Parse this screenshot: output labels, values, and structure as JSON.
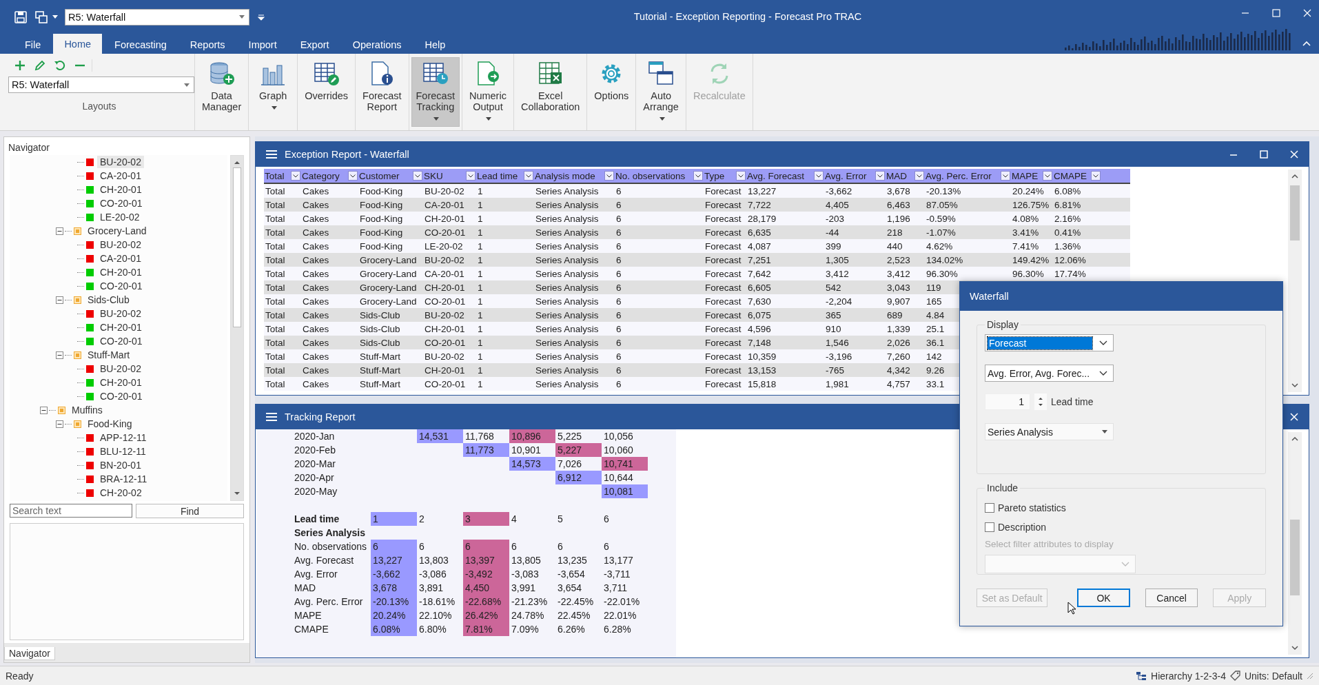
{
  "window": {
    "title": "Tutorial - Exception Reporting - Forecast Pro TRAC",
    "layout_combo": "R5: Waterfall"
  },
  "tabs": [
    {
      "label": "File",
      "selected": false
    },
    {
      "label": "Home",
      "selected": true
    },
    {
      "label": "Forecasting",
      "selected": false
    },
    {
      "label": "Reports",
      "selected": false
    },
    {
      "label": "Import",
      "selected": false
    },
    {
      "label": "Export",
      "selected": false
    },
    {
      "label": "Operations",
      "selected": false
    },
    {
      "label": "Help",
      "selected": false
    }
  ],
  "ribbon": {
    "layouts": {
      "combo": "R5: Waterfall",
      "label": "Layouts"
    },
    "buttons": [
      {
        "label": "Data Manager",
        "dropdown": false,
        "pressed": false,
        "disabled": false
      },
      {
        "label": "Graph",
        "dropdown": true,
        "pressed": false,
        "disabled": false
      },
      {
        "label": "Overrides",
        "dropdown": false,
        "pressed": false,
        "disabled": false
      },
      {
        "label": "Forecast Report",
        "dropdown": false,
        "pressed": false,
        "disabled": false
      },
      {
        "label": "Forecast Tracking",
        "dropdown": true,
        "pressed": true,
        "disabled": false
      },
      {
        "label": "Numeric Output",
        "dropdown": true,
        "pressed": false,
        "disabled": false
      },
      {
        "label": "Excel Collaboration",
        "dropdown": false,
        "pressed": false,
        "disabled": false
      },
      {
        "label": "Options",
        "dropdown": false,
        "pressed": false,
        "disabled": false
      },
      {
        "label": "Auto Arrange",
        "dropdown": true,
        "pressed": false,
        "disabled": false
      },
      {
        "label": "Recalculate",
        "dropdown": false,
        "pressed": false,
        "disabled": true
      }
    ]
  },
  "navigator": {
    "title": "Navigator",
    "tree": [
      {
        "children": [
          {
            "children": [
              {
                "label": "BU-20-02",
                "color": "#ee0000",
                "selected": true
              },
              {
                "label": "CA-20-01",
                "color": "#ee0000",
                "selected": false
              },
              {
                "label": "CH-20-01",
                "color": "#00cc00",
                "selected": false
              },
              {
                "label": "CO-20-01",
                "color": "#00cc00",
                "selected": false
              },
              {
                "label": "LE-20-02",
                "color": "#00cc00",
                "selected": false
              }
            ]
          },
          {
            "label": "Grocery-Land",
            "expanded": true,
            "selected": false,
            "children": [
              {
                "label": "BU-20-02",
                "color": "#ee0000",
                "selected": false
              },
              {
                "label": "CA-20-01",
                "color": "#ee0000",
                "selected": false
              },
              {
                "label": "CH-20-01",
                "color": "#00cc00",
                "selected": false
              },
              {
                "label": "CO-20-01",
                "color": "#00cc00",
                "selected": false
              }
            ]
          },
          {
            "label": "Sids-Club",
            "expanded": true,
            "selected": false,
            "children": [
              {
                "label": "BU-20-02",
                "color": "#ee0000",
                "selected": false
              },
              {
                "label": "CH-20-01",
                "color": "#00cc00",
                "selected": false
              },
              {
                "label": "CO-20-01",
                "color": "#00cc00",
                "selected": false
              }
            ]
          },
          {
            "label": "Stuff-Mart",
            "expanded": true,
            "selected": false,
            "children": [
              {
                "label": "BU-20-02",
                "color": "#ee0000",
                "selected": false
              },
              {
                "label": "CH-20-01",
                "color": "#00cc00",
                "selected": false
              },
              {
                "label": "CO-20-01",
                "color": "#00cc00",
                "selected": false
              }
            ]
          }
        ]
      },
      {
        "label": "Muffins",
        "expanded": true,
        "selected": false,
        "children": [
          {
            "label": "Food-King",
            "expanded": true,
            "selected": false,
            "children": [
              {
                "label": "APP-12-11",
                "color": "#ee0000",
                "selected": false
              },
              {
                "label": "BLU-12-11",
                "color": "#ee0000",
                "selected": false
              },
              {
                "label": "BN-20-01",
                "color": "#ee0000",
                "selected": false
              },
              {
                "label": "BRA-12-11",
                "color": "#ee0000",
                "selected": false
              },
              {
                "label": "CH-20-02",
                "color": "#ee0000",
                "selected": false
              }
            ]
          }
        ]
      }
    ],
    "search": {
      "placeholder": "Search text"
    },
    "find_button": "Find",
    "tab": "Navigator"
  },
  "exception_report": {
    "title": "Exception Report - Waterfall",
    "columns": [
      "Total",
      "Category",
      "Customer",
      "SKU",
      "Lead time",
      "Analysis mode",
      "No. observations",
      "Type",
      "Avg. Forecast",
      "Avg. Error",
      "MAD",
      "Avg. Perc. Error",
      "MAPE",
      "CMAPE"
    ],
    "rows": [
      [
        "Total",
        "Cakes",
        "Food-King",
        "BU-20-02",
        "1",
        "Series Analysis",
        "6",
        "Forecast",
        "13,227",
        "-3,662",
        "3,678",
        "-20.13%",
        "20.24%",
        "6.08%"
      ],
      [
        "Total",
        "Cakes",
        "Food-King",
        "CA-20-01",
        "1",
        "Series Analysis",
        "6",
        "Forecast",
        "7,722",
        "4,405",
        "6,463",
        "87.05%",
        "126.75%",
        "6.81%"
      ],
      [
        "Total",
        "Cakes",
        "Food-King",
        "CH-20-01",
        "1",
        "Series Analysis",
        "6",
        "Forecast",
        "28,179",
        "-203",
        "1,196",
        "-0.59%",
        "4.08%",
        "2.16%"
      ],
      [
        "Total",
        "Cakes",
        "Food-King",
        "CO-20-01",
        "1",
        "Series Analysis",
        "6",
        "Forecast",
        "6,635",
        "-44",
        "218",
        "-1.07%",
        "3.41%",
        "0.41%"
      ],
      [
        "Total",
        "Cakes",
        "Food-King",
        "LE-20-02",
        "1",
        "Series Analysis",
        "6",
        "Forecast",
        "4,087",
        "399",
        "440",
        "4.62%",
        "7.41%",
        "1.36%"
      ],
      [
        "Total",
        "Cakes",
        "Grocery-Land",
        "BU-20-02",
        "1",
        "Series Analysis",
        "6",
        "Forecast",
        "7,251",
        "1,305",
        "2,523",
        "134.02%",
        "149.42%",
        "12.06%"
      ],
      [
        "Total",
        "Cakes",
        "Grocery-Land",
        "CA-20-01",
        "1",
        "Series Analysis",
        "6",
        "Forecast",
        "7,642",
        "3,412",
        "3,412",
        "96.30%",
        "96.30%",
        "17.74%"
      ],
      [
        "Total",
        "Cakes",
        "Grocery-Land",
        "CH-20-01",
        "1",
        "Series Analysis",
        "6",
        "Forecast",
        "6,605",
        "542",
        "3,043",
        "119"
      ],
      [
        "Total",
        "Cakes",
        "Grocery-Land",
        "CO-20-01",
        "1",
        "Series Analysis",
        "6",
        "Forecast",
        "7,630",
        "-2,204",
        "9,907",
        "165"
      ],
      [
        "Total",
        "Cakes",
        "Sids-Club",
        "BU-20-02",
        "1",
        "Series Analysis",
        "6",
        "Forecast",
        "6,075",
        "365",
        "689",
        "4.84"
      ],
      [
        "Total",
        "Cakes",
        "Sids-Club",
        "CH-20-01",
        "1",
        "Series Analysis",
        "6",
        "Forecast",
        "4,596",
        "910",
        "1,339",
        "25.1"
      ],
      [
        "Total",
        "Cakes",
        "Sids-Club",
        "CO-20-01",
        "1",
        "Series Analysis",
        "6",
        "Forecast",
        "7,148",
        "1,546",
        "2,026",
        "36.1"
      ],
      [
        "Total",
        "Cakes",
        "Stuff-Mart",
        "BU-20-02",
        "1",
        "Series Analysis",
        "6",
        "Forecast",
        "10,359",
        "-3,196",
        "7,260",
        "142"
      ],
      [
        "Total",
        "Cakes",
        "Stuff-Mart",
        "CH-20-01",
        "1",
        "Series Analysis",
        "6",
        "Forecast",
        "13,153",
        "-765",
        "4,342",
        "9.26"
      ],
      [
        "Total",
        "Cakes",
        "Stuff-Mart",
        "CO-20-01",
        "1",
        "Series Analysis",
        "6",
        "Forecast",
        "15,818",
        "1,981",
        "4,757",
        "33.1"
      ]
    ]
  },
  "tracking_report": {
    "title": "Tracking Report",
    "waterfall": [
      {
        "label": "2020-Jan",
        "cells": [
          null,
          {
            "value": "14,531",
            "color": "#9999ff"
          },
          {
            "value": "11,768"
          },
          {
            "value": "10,896",
            "color": "#cc6699"
          },
          {
            "value": "5,225"
          },
          {
            "value": "10,056"
          }
        ]
      },
      {
        "label": "2020-Feb",
        "cells": [
          null,
          null,
          {
            "value": "11,773",
            "color": "#9999ff"
          },
          {
            "value": "10,901"
          },
          {
            "value": "5,227",
            "color": "#cc6699"
          },
          {
            "value": "10,060"
          }
        ]
      },
      {
        "label": "2020-Mar",
        "cells": [
          null,
          null,
          null,
          {
            "value": "14,573",
            "color": "#9999ff"
          },
          {
            "value": "7,026"
          },
          {
            "value": "10,741",
            "color": "#cc6699"
          }
        ]
      },
      {
        "label": "2020-Apr",
        "cells": [
          null,
          null,
          null,
          null,
          {
            "value": "6,912",
            "color": "#9999ff"
          },
          {
            "value": "10,644"
          }
        ]
      },
      {
        "label": "2020-May",
        "cells": [
          null,
          null,
          null,
          null,
          null,
          {
            "value": "10,081",
            "color": "#9999ff"
          }
        ]
      }
    ],
    "lead_label": "Lead time",
    "leads": [
      {
        "value": "1",
        "color": "#9999ff"
      },
      {
        "value": "2"
      },
      {
        "value": "3",
        "color": "#cc6699"
      },
      {
        "value": "4"
      },
      {
        "value": "5"
      },
      {
        "value": "6"
      }
    ],
    "section": "Series Analysis",
    "stats": [
      {
        "label": "No. observations",
        "values": [
          "6",
          "6",
          "6",
          "6",
          "6",
          "6"
        ]
      },
      {
        "label": "Avg. Forecast",
        "values": [
          "13,227",
          "13,803",
          "13,397",
          "13,805",
          "13,235",
          "13,177"
        ]
      },
      {
        "label": "Avg. Error",
        "values": [
          "-3,662",
          "-3,086",
          "-3,492",
          "-3,083",
          "-3,654",
          "-3,711"
        ]
      },
      {
        "label": "MAD",
        "values": [
          "3,678",
          "3,891",
          "4,450",
          "3,991",
          "3,654",
          "3,711"
        ]
      },
      {
        "label": "Avg. Perc. Error",
        "values": [
          "-20.13%",
          "-18.61%",
          "-22.68%",
          "-21.23%",
          "-22.45%",
          "-22.01%"
        ]
      },
      {
        "label": "MAPE",
        "values": [
          "20.24%",
          "22.10%",
          "26.42%",
          "24.78%",
          "22.45%",
          "22.01%"
        ]
      },
      {
        "label": "CMAPE",
        "values": [
          "6.08%",
          "6.80%",
          "7.81%",
          "7.09%",
          "6.26%",
          "6.28%"
        ]
      }
    ]
  },
  "dialog": {
    "title": "Waterfall",
    "display": {
      "legend": "Display",
      "view_select": {
        "value": "Forecast",
        "focused": true
      },
      "stats_select": {
        "value": "Avg. Error, Avg. Forec...",
        "focused": false
      },
      "lead_time": {
        "value": "1",
        "label": "Lead time"
      },
      "mode_select": "Series Analysis"
    },
    "include": {
      "legend": "Include",
      "checkboxes": [
        {
          "label": "Pareto statistics",
          "checked": false
        },
        {
          "label": "Description",
          "checked": false
        }
      ],
      "filter_hint": "Select filter attributes to display"
    },
    "buttons": [
      {
        "label": "Set as Default",
        "disabled": true,
        "default": false
      },
      {
        "label": "OK",
        "disabled": false,
        "default": true
      },
      {
        "label": "Cancel",
        "disabled": false,
        "default": false
      },
      {
        "label": "Apply",
        "disabled": true,
        "default": false
      }
    ]
  },
  "status_bar": {
    "text": "Ready",
    "hierarchy": "Hierarchy 1-2-3-4",
    "units": "Units: Default"
  }
}
